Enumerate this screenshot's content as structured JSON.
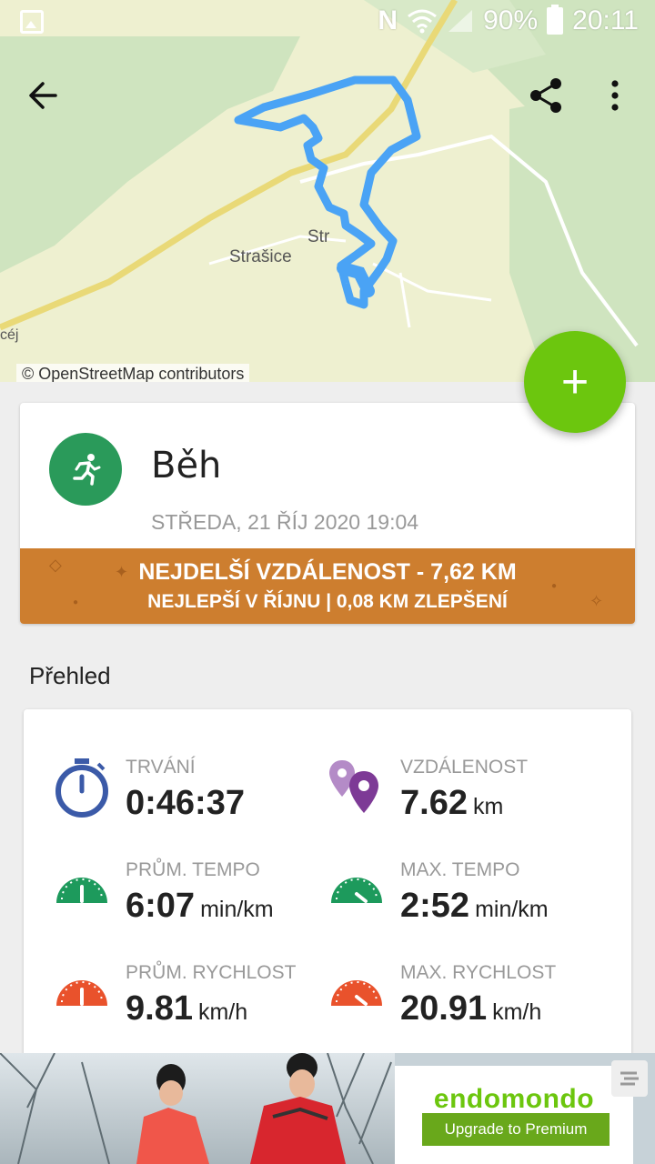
{
  "status_bar": {
    "battery": "90%",
    "time": "20:11",
    "net_letter": "N"
  },
  "map": {
    "town": "Strašice",
    "town_partial": "Str",
    "attribution": "© OpenStreetMap contributors",
    "left_partial": "céj"
  },
  "toolbar": {
    "back_icon": "back-arrow-icon",
    "share_icon": "share-icon",
    "more_icon": "more-vert-icon"
  },
  "fab": {
    "label": "+"
  },
  "activity": {
    "sport": "Běh",
    "date": "STŘEDA, 21 ŘÍJ 2020 19:04",
    "record_line1": "NEJDELŠÍ VZDÁLENOST  -  7,62 KM",
    "record_line2": "NEJLEPŠÍ V ŘÍJNU  |  0,08 KM ZLEPŠENÍ"
  },
  "overview": {
    "title": "Přehled",
    "stats": [
      {
        "label": "TRVÁNÍ",
        "value": "0:46:37",
        "unit": ""
      },
      {
        "label": "VZDÁLENOST",
        "value": "7.62",
        "unit": "km"
      },
      {
        "label": "PRŮM. TEMPO",
        "value": "6:07",
        "unit": "min/km"
      },
      {
        "label": "MAX. TEMPO",
        "value": "2:52",
        "unit": "min/km"
      },
      {
        "label": "PRŮM. RYCHLOST",
        "value": "9.81",
        "unit": "km/h"
      },
      {
        "label": "MAX. RYCHLOST",
        "value": "20.91",
        "unit": "km/h"
      }
    ]
  },
  "ad": {
    "brand": "endomondo",
    "button": "Upgrade to Premium"
  },
  "colors": {
    "accent": "#6cc60e",
    "record": "#cd7e2f",
    "route": "#4aa3f5",
    "sport": "#2a9a5a"
  }
}
